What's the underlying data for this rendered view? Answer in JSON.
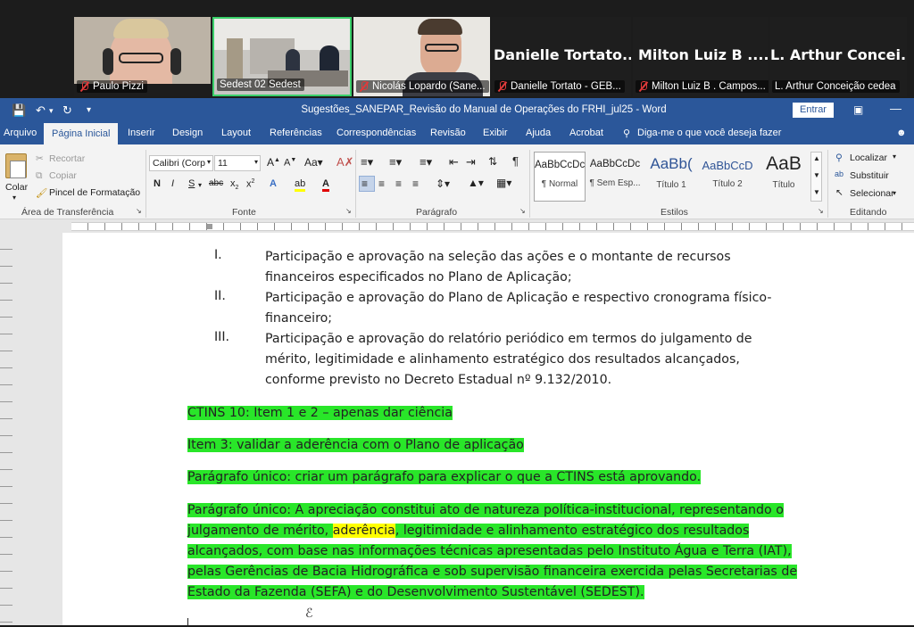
{
  "meeting": {
    "participants": [
      {
        "name": "Paulo Pizzi",
        "muted": true
      },
      {
        "name": "Sedest 02 Sedest",
        "muted": false,
        "active": true
      },
      {
        "name": "Nicolás Lopardo (Sane...",
        "muted": true
      },
      {
        "name": "Danielle Tortato - GEB...",
        "display": "Danielle  Tortato...",
        "muted": true
      },
      {
        "name": "Milton Luiz B . Campos...",
        "display": "Milton Luiz B ....",
        "muted": true
      },
      {
        "name": "L. Arthur Conceição  cedea",
        "display": "L. Arthur Concei...",
        "muted": false
      }
    ]
  },
  "word": {
    "title": "Sugestões_SANEPAR_Revisão do Manual de Operações do FRHI_jul25  -  Word",
    "signin": "Entrar",
    "tabs": [
      "Arquivo",
      "Página Inicial",
      "Inserir",
      "Design",
      "Layout",
      "Referências",
      "Correspondências",
      "Revisão",
      "Exibir",
      "Ajuda",
      "Acrobat"
    ],
    "tell_me": "Diga-me o que você deseja fazer",
    "clipboard": {
      "paste": "Colar",
      "cut": "Recortar",
      "copy": "Copiar",
      "format_painter": "Pincel de Formatação",
      "label": "Área de Transferência"
    },
    "font": {
      "name": "Calibri (Corp",
      "size": "11",
      "label": "Fonte"
    },
    "paragraph": {
      "label": "Parágrafo"
    },
    "styles": {
      "label": "Estilos",
      "items": [
        {
          "sample": "AaBbCcDc",
          "name": "¶ Normal"
        },
        {
          "sample": "AaBbCcDc",
          "name": "¶ Sem Esp..."
        },
        {
          "sample": "AaBb(",
          "name": "Título 1"
        },
        {
          "sample": "AaBbCcD",
          "name": "Título 2"
        },
        {
          "sample": "AaB",
          "name": "Título"
        }
      ]
    },
    "editing": {
      "find": "Localizar",
      "replace": "Substituir",
      "select": "Selecionar",
      "label": "Editando"
    }
  },
  "document": {
    "list": [
      {
        "num": "I.",
        "lines": [
          "Participação e aprovação na seleção das ações e o montante de recursos",
          "financeiros especificados no Plano de Aplicação;"
        ]
      },
      {
        "num": "II.",
        "lines": [
          "Participação e aprovação do Plano de Aplicação e respectivo cronograma físico-",
          "financeiro;"
        ]
      },
      {
        "num": "III.",
        "lines": [
          "Participação e aprovação do relatório periódico em termos do julgamento de",
          "mérito, legitimidade e alinhamento estratégico dos resultados alcançados,",
          "conforme previsto no Decreto Estadual nº 9.132/2010."
        ]
      }
    ],
    "notes": [
      "CTINS 10: Item 1 e 2 – apenas dar ciência",
      "Item 3: validar a aderência com o Plano de aplicação",
      "Parágrafo único: criar um parágrafo para explicar o que a CTINS está aprovando."
    ],
    "final_paragraph": {
      "line1": "Parágrafo único: A apreciação constitui ato de natureza política-institucional, representando o",
      "line2_pre": "julgamento de mérito, ",
      "line2_highlight": "aderência",
      "line2_post": ", legitimidade e alinhamento estratégico dos resultados",
      "line3": "alcançados, com base nas informações técnicas apresentadas pelo Instituto Água e Terra (IAT),",
      "line4": "pelas Gerências de Bacia Hidrográfica e sob supervisão financeira exercida pelas Secretarias de",
      "line5": "Estado da Fazenda (SEFA) e do Desenvolvimento Sustentável (SEDEST)."
    }
  }
}
